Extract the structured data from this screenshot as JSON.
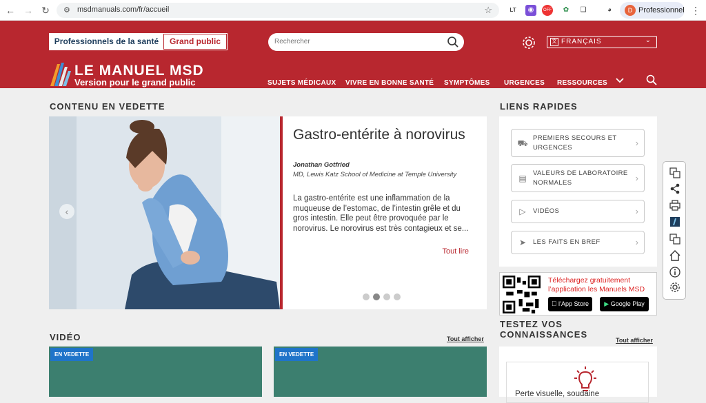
{
  "browser": {
    "url": "msdmanuals.com/fr/accueil",
    "profile_label": "Professionnel",
    "profile_initial": "D",
    "ext_lt": "LT",
    "ext_off": "OFF"
  },
  "header": {
    "audience_pro": "Professionnels de la santé",
    "audience_public": "Grand public",
    "search_placeholder": "Rechercher",
    "language": "FRANÇAIS",
    "logo_title": "LE MANUEL MSD",
    "logo_subtitle": "Version pour le grand public",
    "menu": [
      "SUJETS MÉDICAUX",
      "VIVRE EN BONNE SANTÉ",
      "SYMPTÔMES",
      "URGENCES",
      "RESSOURCES"
    ]
  },
  "featured": {
    "section_title": "CONTENU EN VEDETTE",
    "title": "Gastro-entérite à norovirus",
    "author": "Jonathan Gotfried",
    "affiliation": "MD, Lewis Katz School of Medicine at Temple University",
    "text": "La gastro-entérite est une inflammation de la muqueuse de l’estomac, de l’intestin grêle et du gros intestin. Elle peut être provoquée par le norovirus. Le norovirus est très contagieux et se...",
    "read_more": "Tout lire",
    "active_slide": 2,
    "slide_count": 4
  },
  "quick_links": {
    "section_title": "LIENS RAPIDES",
    "items": [
      {
        "label": "PREMIERS SECOURS ET URGENCES",
        "icon": "ambulance-icon"
      },
      {
        "label": "VALEURS DE LABORATOIRE NORMALES",
        "icon": "lab-report-icon"
      },
      {
        "label": "VIDÉOS",
        "icon": "play-icon"
      },
      {
        "label": "LES FAITS EN BREF",
        "icon": "megaphone-icon"
      }
    ]
  },
  "app_promo": {
    "line1": "Téléchargez gratuitement",
    "line2": "l’application les Manuels MSD",
    "app_store_small": "Télécharger dans",
    "app_store": "l’App Store",
    "google_small": "DISPONIBLE SUR",
    "google": "Google Play"
  },
  "video": {
    "section_title": "VIDÉO",
    "see_all": "Tout afficher",
    "badge": "EN VEDETTE"
  },
  "quiz": {
    "section_title": "TESTEZ VOS CONNAISSANCES",
    "see_all": "Tout afficher",
    "question_start": "Perte visuelle, soudaine"
  },
  "colors": {
    "brand_red": "#b8272f",
    "badge_blue": "#1f74c9",
    "video_green": "#3c7f6f"
  }
}
